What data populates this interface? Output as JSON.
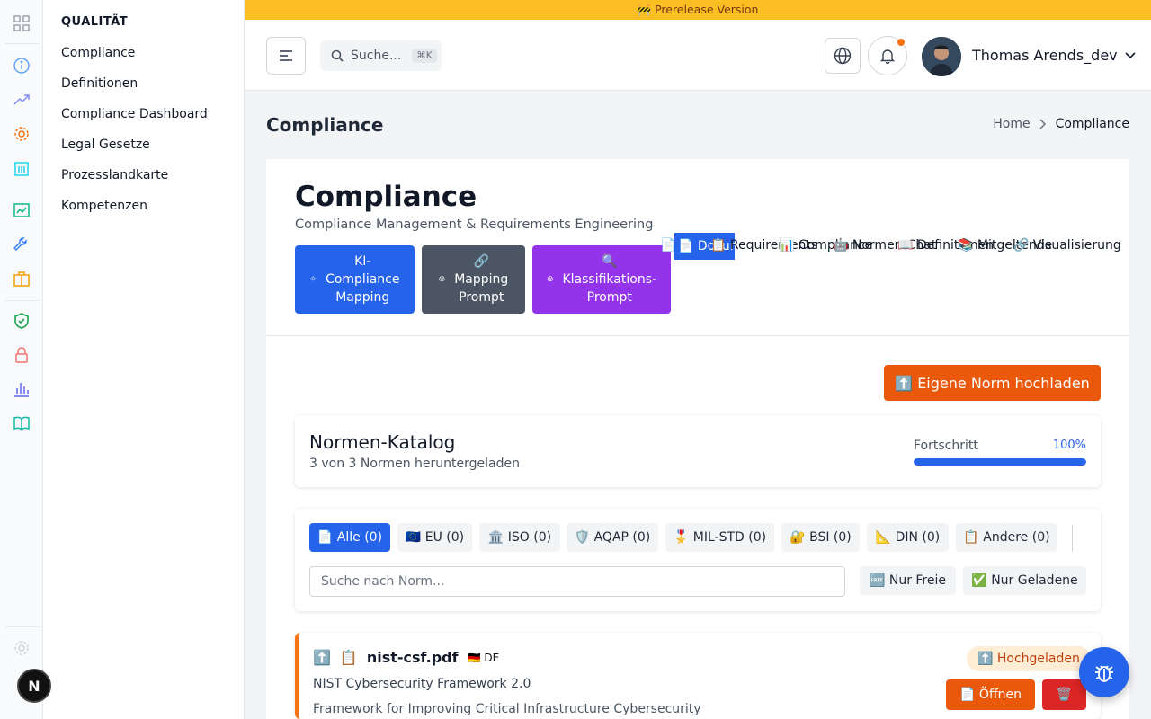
{
  "colors": {
    "accent": "#2563eb",
    "banner": "#fbbf24",
    "upload": "#ea580c",
    "danger": "#dc2626",
    "purple": "#9333ea",
    "slate": "#4b5563"
  },
  "rail": {
    "icons": [
      "grid-icon",
      "info-icon",
      "trending-icon",
      "gear-icon",
      "building-icon",
      "chart-icon",
      "wrench-icon",
      "briefcase-icon",
      "shield-check-icon",
      "lock-icon",
      "bar-chart-icon",
      "book-icon",
      "settings-icon"
    ],
    "user_initial": "N"
  },
  "submenu": {
    "heading": "QUALITÄT",
    "items": [
      "Compliance",
      "Definitionen",
      "Compliance Dashboard",
      "Legal Gesetze",
      "Prozesslandkarte",
      "Kompetenzen"
    ]
  },
  "banner": {
    "text": "🚧 Prerelease Version"
  },
  "header": {
    "search_placeholder": "Suche...",
    "search_shortcut": "⌘K",
    "user_name": "Thomas Arends_dev"
  },
  "page": {
    "title": "Compliance",
    "breadcrumb_home": "Home",
    "breadcrumb_current": "Compliance"
  },
  "hero": {
    "title": "Compliance",
    "subtitle": "Compliance Management & Requirements Engineering",
    "tools": [
      {
        "icon": "✧",
        "label": "KI-\nCompliance\nMapping"
      },
      {
        "icon": "🔗",
        "label": "Mapping\nPrompt"
      },
      {
        "icon": "🔍",
        "label": "Klassifikations-\nPrompt"
      }
    ],
    "tabs": [
      "📄 Dokumente",
      "📋 Requirements",
      "📊 Compliance",
      "🤖 Normen-Chat",
      "📖 Definitionen",
      "📚 Mitgeltende",
      "🔗 Visualisierung"
    ]
  },
  "upload": {
    "label": "⬆️ Eigene Norm hochladen"
  },
  "catalog": {
    "title": "Normen-Katalog",
    "subtitle": "3 von 3 Normen heruntergeladen",
    "progress_label": "Fortschritt",
    "progress_value": "100%",
    "progress": 1.0
  },
  "filters": {
    "chips": [
      "📄 Alle (0)",
      "🇪🇺 EU (0)",
      "🏛️ ISO (0)",
      "🛡️ AQAP (0)",
      "🎖️ MIL-STD (0)",
      "🔐 BSI (0)",
      "📐 DIN (0)",
      "📋 Andere (0)"
    ],
    "search_placeholder": "Suche nach Norm...",
    "free_only": "🆓 Nur Freie",
    "loaded_only": "✅ Nur Geladene"
  },
  "norm": {
    "upload_icon": "⬆️",
    "doc_icon": "📋",
    "filename": "nist-csf.pdf",
    "lang": "🇩🇪 DE",
    "title": "NIST Cybersecurity Framework 2.0",
    "description": "Framework for Improving Critical Infrastructure Cybersecurity",
    "badge": "⬆️ Hochgeladen",
    "open_label": "📄 Öffnen",
    "delete_label": "🗑️"
  }
}
